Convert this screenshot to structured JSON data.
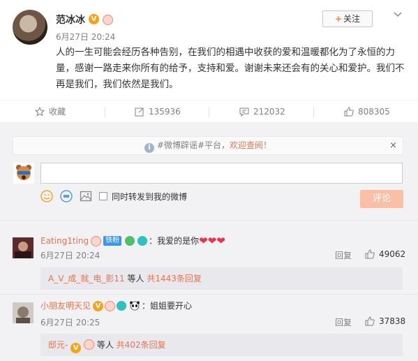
{
  "post": {
    "author": "范冰冰",
    "verified_badge": "V",
    "time": "6月27日 20:24",
    "text": "人的一生可能会经历各种告别，在我们的相遇中收获的爱和温暖都化为了永恒的力量，感谢一路走来你所有的给予，支持和爱。谢谢未来还会有的关心和爱护。我们不再是我们，我们依然是我们。",
    "follow_label": "关注",
    "follow_plus": "+"
  },
  "actions": {
    "favorite": "收藏",
    "repost_count": "135936",
    "comment_count": "212032",
    "like_count": "808305"
  },
  "notice": {
    "prefix": "#微博辟谣#平台，",
    "link": "欢迎查阅！",
    "close": "×",
    "info": "i"
  },
  "composer": {
    "input_value": "",
    "forward_label": "同时转发到我的微博",
    "submit_label": "评论"
  },
  "comments": [
    {
      "user": "Eating1ting",
      "fan_badge": "铁粉",
      "text": "：我爱的是你",
      "hearts": "❤❤❤",
      "time": "6月27日 20:24",
      "reply_label": "回复",
      "likes": "49062",
      "sub_user": "A_V_成_就_电_影11",
      "sub_text": "等人",
      "sub_link": "共1443条回复"
    },
    {
      "user": "小朋友明天见",
      "verified_badge": "V",
      "text": "：姐姐要开心",
      "time": "6月27日 20:25",
      "reply_label": "回复",
      "likes": "37838",
      "sub_user": "邸元-",
      "sub_verified": "V",
      "sub_text": "等人",
      "sub_link": "共402条回复"
    }
  ],
  "colors": {
    "accent": "#eb7350",
    "submit_disabled": "#fbbfa5",
    "verified": "#f7a31a",
    "fan_badge": "#3d97e6",
    "bg_comments": "#f2f2f5"
  }
}
